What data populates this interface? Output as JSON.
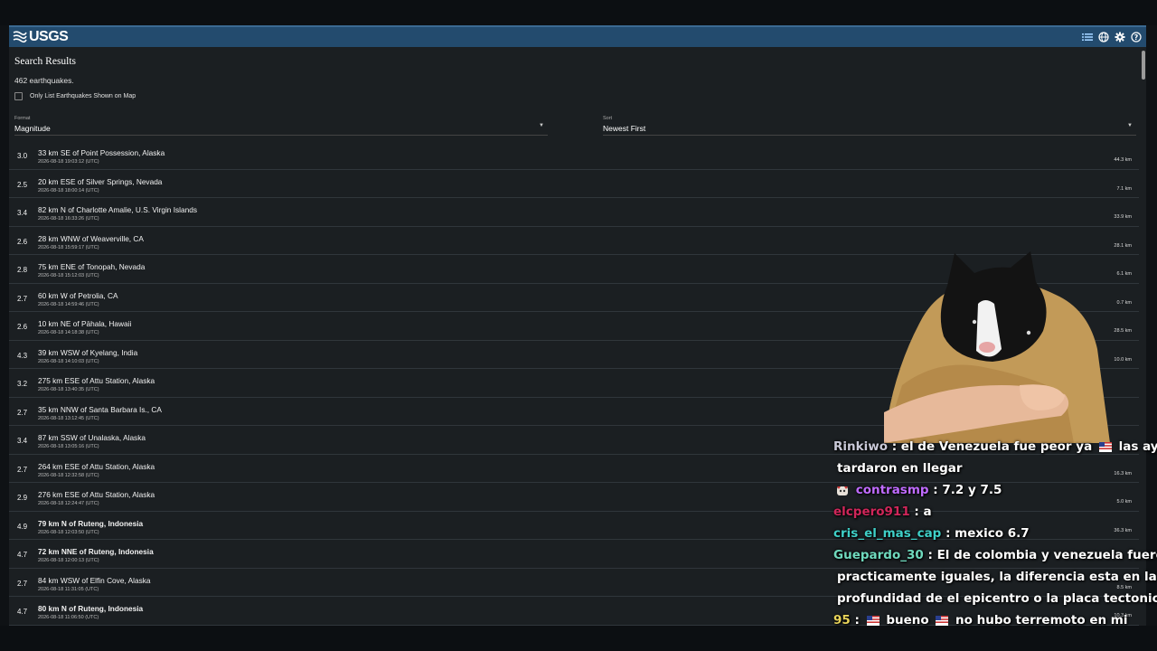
{
  "header": {
    "logo_text": "USGS",
    "icons": [
      "list-icon",
      "globe-icon",
      "gear-icon",
      "help-icon"
    ]
  },
  "search": {
    "title": "Search Results",
    "count": "462 earthquakes.",
    "filter_label": "Only List Earthquakes Shown on Map",
    "format_label": "Format",
    "format_value": "Magnitude",
    "sort_label": "Sort",
    "sort_value": "Newest First"
  },
  "earthquakes": [
    {
      "mag": "3.0",
      "place": "33 km SE of Point Possession, Alaska",
      "time": "2026-08-18 19:03:12 (UTC)",
      "depth": "44.3 km",
      "bold": false
    },
    {
      "mag": "2.5",
      "place": "20 km ESE of Silver Springs, Nevada",
      "time": "2026-08-18 18:00:14 (UTC)",
      "depth": "7.1 km",
      "bold": false
    },
    {
      "mag": "3.4",
      "place": "82 km N of Charlotte Amalie, U.S. Virgin Islands",
      "time": "2026-08-18 16:33:26 (UTC)",
      "depth": "33.9 km",
      "bold": false
    },
    {
      "mag": "2.6",
      "place": "28 km WNW of Weaverville, CA",
      "time": "2026-08-18 15:59:17 (UTC)",
      "depth": "28.1 km",
      "bold": false
    },
    {
      "mag": "2.8",
      "place": "75 km ENE of Tonopah, Nevada",
      "time": "2026-08-18 15:12:03 (UTC)",
      "depth": "6.1 km",
      "bold": false
    },
    {
      "mag": "2.7",
      "place": "60 km W of Petrolia, CA",
      "time": "2026-08-18 14:59:46 (UTC)",
      "depth": "0.7 km",
      "bold": false
    },
    {
      "mag": "2.6",
      "place": "10 km NE of Pāhala, Hawaii",
      "time": "2026-08-18 14:18:38 (UTC)",
      "depth": "28.5 km",
      "bold": false
    },
    {
      "mag": "4.3",
      "place": "39 km WSW of Kyelang, India",
      "time": "2026-08-18 14:10:03 (UTC)",
      "depth": "10.0 km",
      "bold": false
    },
    {
      "mag": "3.2",
      "place": "275 km ESE of Attu Station, Alaska",
      "time": "2026-08-18 13:40:35 (UTC)",
      "depth": "",
      "bold": false
    },
    {
      "mag": "2.7",
      "place": "35 km NNW of Santa Barbara Is., CA",
      "time": "2026-08-18 13:12:45 (UTC)",
      "depth": "",
      "bold": false
    },
    {
      "mag": "3.4",
      "place": "87 km SSW of Unalaska, Alaska",
      "time": "2026-08-18 13:05:16 (UTC)",
      "depth": "",
      "bold": false
    },
    {
      "mag": "2.7",
      "place": "264 km ESE of Attu Station, Alaska",
      "time": "2026-08-18 12:32:58 (UTC)",
      "depth": "16.3 km",
      "bold": false
    },
    {
      "mag": "2.9",
      "place": "276 km ESE of Attu Station, Alaska",
      "time": "2026-08-18 12:24:47 (UTC)",
      "depth": "5.0 km",
      "bold": false
    },
    {
      "mag": "4.9",
      "place": "79 km N of Ruteng, Indonesia",
      "time": "2026-08-18 12:03:50 (UTC)",
      "depth": "36.3 km",
      "bold": true
    },
    {
      "mag": "4.7",
      "place": "72 km NNE of Ruteng, Indonesia",
      "time": "2026-08-18 12:00:13 (UTC)",
      "depth": "",
      "bold": true
    },
    {
      "mag": "2.7",
      "place": "84 km WSW of Elfin Cove, Alaska",
      "time": "2026-08-18 11:31:05 (UTC)",
      "depth": "8.5 km",
      "bold": false
    },
    {
      "mag": "4.7",
      "place": "80 km N of Ruteng, Indonesia",
      "time": "2026-08-18 11:06:50 (UTC)",
      "depth": "10.3 km",
      "bold": true
    }
  ],
  "chat": [
    {
      "user": "Rinkiwo",
      "msg": ": el de Venezuela fue peor ya",
      "msg2": "las ayudas",
      "cont": "tardaron en llegar"
    },
    {
      "user": "contrasmp",
      "msg": ": 7.2 y 7.5"
    },
    {
      "user": "elcpero911",
      "msg": ": a"
    },
    {
      "user": "cris_el_mas_cap",
      "msg": ": mexico 6.7"
    },
    {
      "user": "Guepardo_30",
      "msg": ": El de colombia y venezuela fueron",
      "cont": "practicamente iguales, la diferencia esta en la",
      "cont2": "profundidad de el epicentro o la placa tectonica"
    },
    {
      "user": "95",
      "msg": ":",
      "msg2": "bueno",
      "msg3": "no hubo terremoto en mi"
    }
  ],
  "colors": {
    "header_bg": "#234b6e",
    "panel_bg": "#1b1f22",
    "user_contrasmp": "#c06bff",
    "user_elcpero911": "#d0265a",
    "user_cris": "#3fd0c8",
    "user_guepardo": "#6fd9bd",
    "user_95": "#e8d35a"
  }
}
